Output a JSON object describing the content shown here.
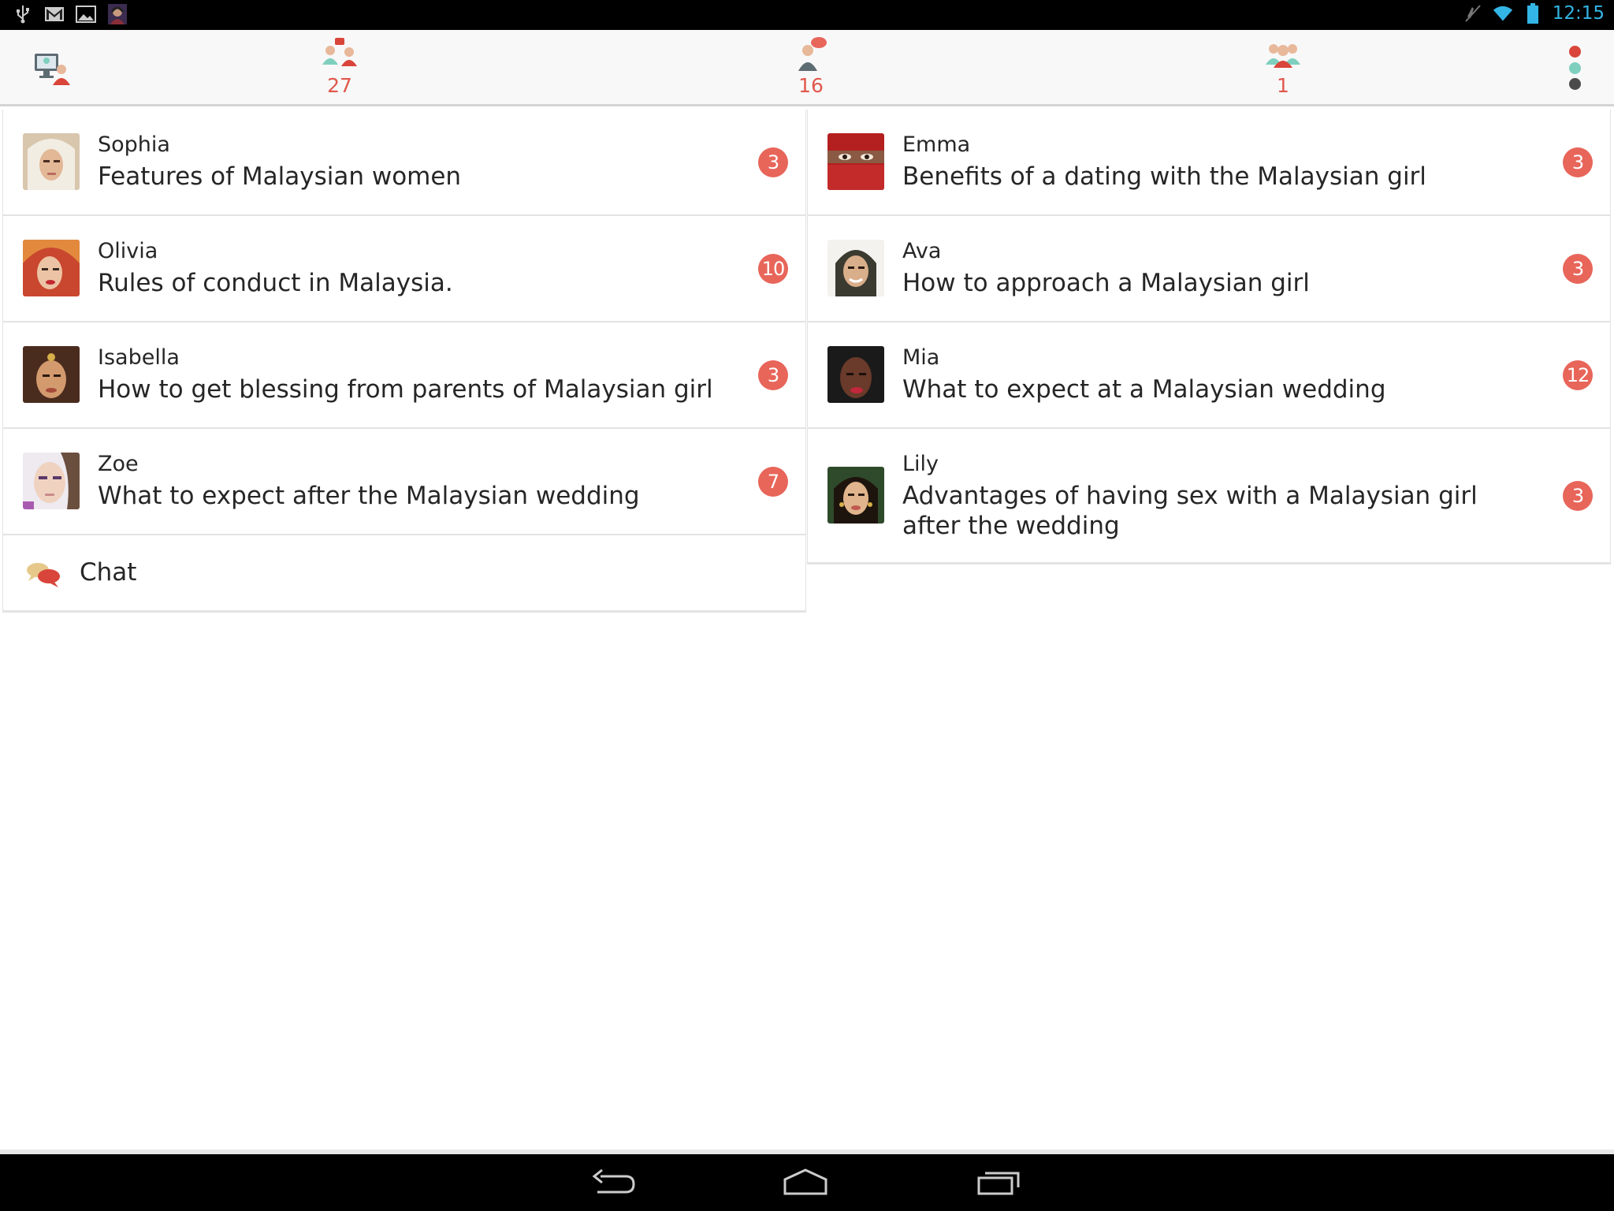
{
  "status_bar": {
    "time": "12:15",
    "left_icons": [
      "usb-icon",
      "gmail-icon",
      "gallery-icon",
      "app-notification-icon"
    ],
    "right_icons": [
      "mute-icon",
      "wifi-icon",
      "battery-icon"
    ]
  },
  "action_bar": {
    "home_icon": "monitor-people-icon",
    "tabs": [
      {
        "icon": "topics-people-icon",
        "count": "27"
      },
      {
        "icon": "person-message-icon",
        "count": "16"
      },
      {
        "icon": "group-icon",
        "count": "1"
      }
    ],
    "menu_colors": [
      "#d9453a",
      "#7fcfbf",
      "#4a4a4a"
    ]
  },
  "left_column": [
    {
      "author": "Sophia",
      "title": "Features of Malaysian women",
      "badge": "3"
    },
    {
      "author": "Olivia",
      "title": "Rules of conduct in Malaysia.",
      "badge": "10"
    },
    {
      "author": "Isabella",
      "title": "How to get blessing from parents of Malaysian girl",
      "badge": "3"
    },
    {
      "author": "Zoe",
      "title": "What to expect after the Malaysian wedding",
      "badge": "7"
    }
  ],
  "chat": {
    "label": "Chat"
  },
  "right_column": [
    {
      "author": "Emma",
      "title": "Benefits of a dating with the Malaysian girl",
      "badge": "3"
    },
    {
      "author": "Ava",
      "title": "How to approach a Malaysian girl",
      "badge": "3"
    },
    {
      "author": "Mia",
      "title": "What to expect at a Malaysian wedding",
      "badge": "12"
    },
    {
      "author": "Lily",
      "title": "Advantages of having sex with a Malaysian girl after the wedding",
      "badge": "3"
    }
  ],
  "colors": {
    "accent": "#e0574c",
    "badge": "#e8655a",
    "holo_blue": "#33b5e5"
  }
}
